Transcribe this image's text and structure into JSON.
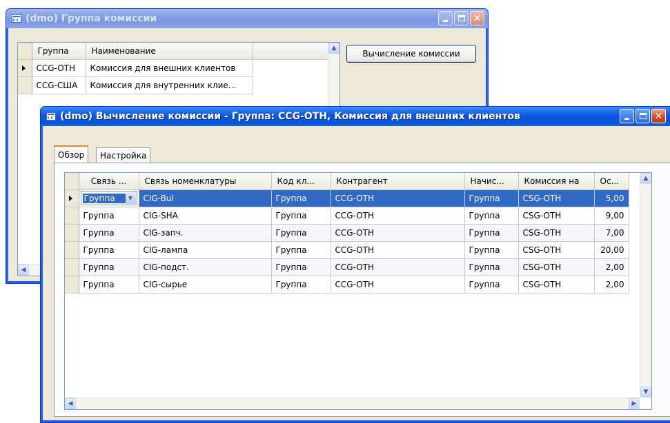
{
  "back_window": {
    "title": "(dmo) Группа комиссии",
    "grid": {
      "headers": [
        "Группа",
        "Наименование"
      ],
      "rows": [
        {
          "group": "CCG-OTH",
          "name": "Комиссия для внешних клиентов"
        },
        {
          "group": "CCG-США",
          "name": "Комиссия для внутренних клие..."
        }
      ]
    },
    "calc_button": "Вычисление комиссии"
  },
  "front_window": {
    "title": "(dmo) Вычисление комиссии - Группа: CCG-OTH, Комиссия для внешних клиентов",
    "tabs": [
      "Обзор",
      "Настройка"
    ],
    "grid": {
      "headers": [
        "Связь ...",
        "Связь номенклатуры",
        "Код кл...",
        "Контрагент",
        "Начис...",
        "Комиссия на",
        "Ос..."
      ],
      "rows": [
        {
          "link": "Группа",
          "item": "CIG-Bul",
          "code": "Группа",
          "cp": "CCG-OTH",
          "accr": "Группа",
          "comm": "CSG-OTH",
          "val": "5,00"
        },
        {
          "link": "Группа",
          "item": "CIG-SHA",
          "code": "Группа",
          "cp": "CCG-OTH",
          "accr": "Группа",
          "comm": "CSG-OTH",
          "val": "9,00"
        },
        {
          "link": "Группа",
          "item": "CIG-запч.",
          "code": "Группа",
          "cp": "CCG-OTH",
          "accr": "Группа",
          "comm": "CSG-OTH",
          "val": "7,00"
        },
        {
          "link": "Группа",
          "item": "CIG-лампа",
          "code": "Группа",
          "cp": "CCG-OTH",
          "accr": "Группа",
          "comm": "CSG-OTH",
          "val": "20,00"
        },
        {
          "link": "Группа",
          "item": "CIG-подст.",
          "code": "Группа",
          "cp": "CCG-OTH",
          "accr": "Группа",
          "comm": "CSG-OTH",
          "val": "2,00"
        },
        {
          "link": "Группа",
          "item": "CIG-сырье",
          "code": "Группа",
          "cp": "CCG-OTH",
          "accr": "Группа",
          "comm": "CSG-OTH",
          "val": "2,00"
        }
      ]
    }
  },
  "colors": {
    "selection": "#316ac5",
    "titlebar_active": "#0855dd",
    "titlebar_inactive": "#7b95e2"
  }
}
